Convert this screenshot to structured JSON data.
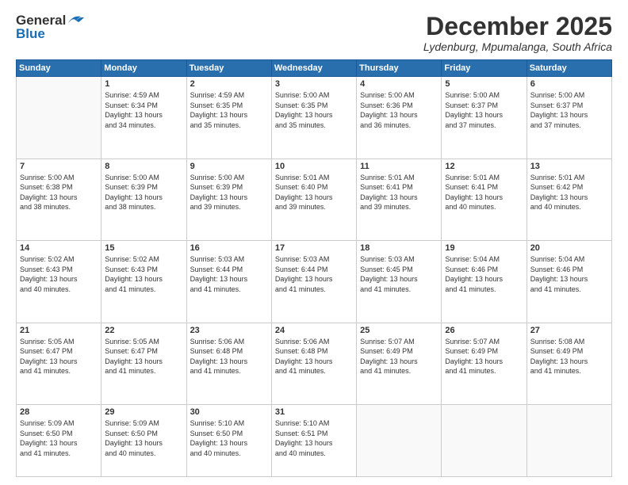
{
  "header": {
    "logo_general": "General",
    "logo_blue": "Blue",
    "month_title": "December 2025",
    "subtitle": "Lydenburg, Mpumalanga, South Africa"
  },
  "weekdays": [
    "Sunday",
    "Monday",
    "Tuesday",
    "Wednesday",
    "Thursday",
    "Friday",
    "Saturday"
  ],
  "weeks": [
    [
      {
        "day": "",
        "info": ""
      },
      {
        "day": "1",
        "info": "Sunrise: 4:59 AM\nSunset: 6:34 PM\nDaylight: 13 hours\nand 34 minutes."
      },
      {
        "day": "2",
        "info": "Sunrise: 4:59 AM\nSunset: 6:35 PM\nDaylight: 13 hours\nand 35 minutes."
      },
      {
        "day": "3",
        "info": "Sunrise: 5:00 AM\nSunset: 6:35 PM\nDaylight: 13 hours\nand 35 minutes."
      },
      {
        "day": "4",
        "info": "Sunrise: 5:00 AM\nSunset: 6:36 PM\nDaylight: 13 hours\nand 36 minutes."
      },
      {
        "day": "5",
        "info": "Sunrise: 5:00 AM\nSunset: 6:37 PM\nDaylight: 13 hours\nand 37 minutes."
      },
      {
        "day": "6",
        "info": "Sunrise: 5:00 AM\nSunset: 6:37 PM\nDaylight: 13 hours\nand 37 minutes."
      }
    ],
    [
      {
        "day": "7",
        "info": "Sunrise: 5:00 AM\nSunset: 6:38 PM\nDaylight: 13 hours\nand 38 minutes."
      },
      {
        "day": "8",
        "info": "Sunrise: 5:00 AM\nSunset: 6:39 PM\nDaylight: 13 hours\nand 38 minutes."
      },
      {
        "day": "9",
        "info": "Sunrise: 5:00 AM\nSunset: 6:39 PM\nDaylight: 13 hours\nand 39 minutes."
      },
      {
        "day": "10",
        "info": "Sunrise: 5:01 AM\nSunset: 6:40 PM\nDaylight: 13 hours\nand 39 minutes."
      },
      {
        "day": "11",
        "info": "Sunrise: 5:01 AM\nSunset: 6:41 PM\nDaylight: 13 hours\nand 39 minutes."
      },
      {
        "day": "12",
        "info": "Sunrise: 5:01 AM\nSunset: 6:41 PM\nDaylight: 13 hours\nand 40 minutes."
      },
      {
        "day": "13",
        "info": "Sunrise: 5:01 AM\nSunset: 6:42 PM\nDaylight: 13 hours\nand 40 minutes."
      }
    ],
    [
      {
        "day": "14",
        "info": "Sunrise: 5:02 AM\nSunset: 6:43 PM\nDaylight: 13 hours\nand 40 minutes."
      },
      {
        "day": "15",
        "info": "Sunrise: 5:02 AM\nSunset: 6:43 PM\nDaylight: 13 hours\nand 41 minutes."
      },
      {
        "day": "16",
        "info": "Sunrise: 5:03 AM\nSunset: 6:44 PM\nDaylight: 13 hours\nand 41 minutes."
      },
      {
        "day": "17",
        "info": "Sunrise: 5:03 AM\nSunset: 6:44 PM\nDaylight: 13 hours\nand 41 minutes."
      },
      {
        "day": "18",
        "info": "Sunrise: 5:03 AM\nSunset: 6:45 PM\nDaylight: 13 hours\nand 41 minutes."
      },
      {
        "day": "19",
        "info": "Sunrise: 5:04 AM\nSunset: 6:46 PM\nDaylight: 13 hours\nand 41 minutes."
      },
      {
        "day": "20",
        "info": "Sunrise: 5:04 AM\nSunset: 6:46 PM\nDaylight: 13 hours\nand 41 minutes."
      }
    ],
    [
      {
        "day": "21",
        "info": "Sunrise: 5:05 AM\nSunset: 6:47 PM\nDaylight: 13 hours\nand 41 minutes."
      },
      {
        "day": "22",
        "info": "Sunrise: 5:05 AM\nSunset: 6:47 PM\nDaylight: 13 hours\nand 41 minutes."
      },
      {
        "day": "23",
        "info": "Sunrise: 5:06 AM\nSunset: 6:48 PM\nDaylight: 13 hours\nand 41 minutes."
      },
      {
        "day": "24",
        "info": "Sunrise: 5:06 AM\nSunset: 6:48 PM\nDaylight: 13 hours\nand 41 minutes."
      },
      {
        "day": "25",
        "info": "Sunrise: 5:07 AM\nSunset: 6:49 PM\nDaylight: 13 hours\nand 41 minutes."
      },
      {
        "day": "26",
        "info": "Sunrise: 5:07 AM\nSunset: 6:49 PM\nDaylight: 13 hours\nand 41 minutes."
      },
      {
        "day": "27",
        "info": "Sunrise: 5:08 AM\nSunset: 6:49 PM\nDaylight: 13 hours\nand 41 minutes."
      }
    ],
    [
      {
        "day": "28",
        "info": "Sunrise: 5:09 AM\nSunset: 6:50 PM\nDaylight: 13 hours\nand 41 minutes."
      },
      {
        "day": "29",
        "info": "Sunrise: 5:09 AM\nSunset: 6:50 PM\nDaylight: 13 hours\nand 40 minutes."
      },
      {
        "day": "30",
        "info": "Sunrise: 5:10 AM\nSunset: 6:50 PM\nDaylight: 13 hours\nand 40 minutes."
      },
      {
        "day": "31",
        "info": "Sunrise: 5:10 AM\nSunset: 6:51 PM\nDaylight: 13 hours\nand 40 minutes."
      },
      {
        "day": "",
        "info": ""
      },
      {
        "day": "",
        "info": ""
      },
      {
        "day": "",
        "info": ""
      }
    ]
  ]
}
